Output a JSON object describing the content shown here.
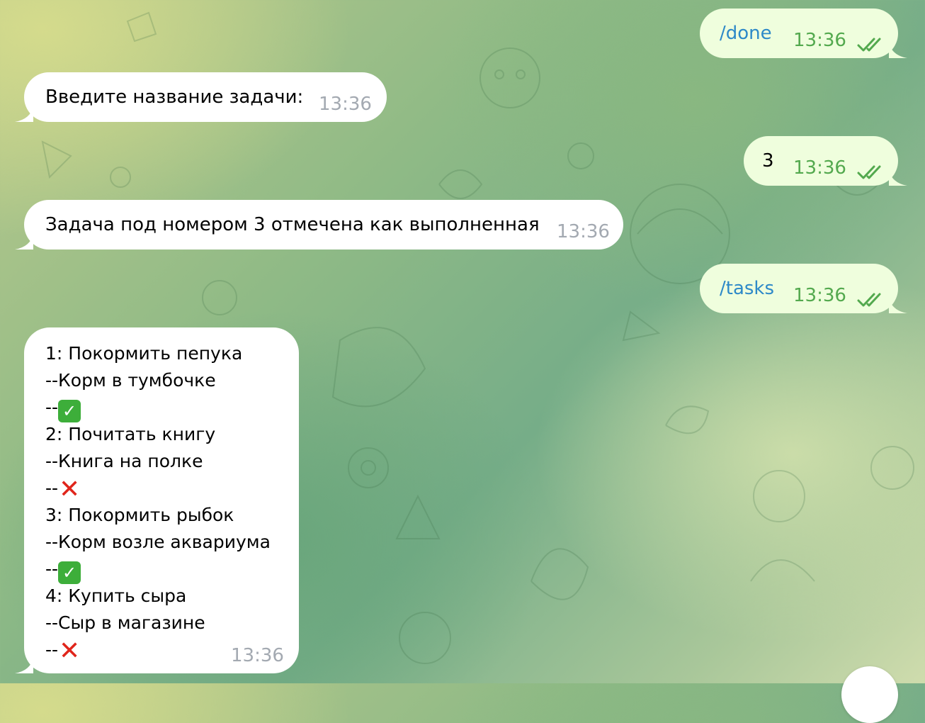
{
  "colors": {
    "incoming_bubble": "#ffffff",
    "outgoing_bubble": "#effedd",
    "command_link": "#2d89c8",
    "outgoing_time": "#53a94e",
    "incoming_time": "#a3a9b1",
    "done_mark": "#3dae3a",
    "not_done_mark": "#e0251b"
  },
  "messages": [
    {
      "direction": "out",
      "text": "/done",
      "time": "13:36",
      "status_icon": "double-check-icon"
    },
    {
      "direction": "in",
      "text": "Введите название задачи:",
      "time": "13:36"
    },
    {
      "direction": "out",
      "text": "3",
      "time": "13:36",
      "status_icon": "double-check-icon"
    },
    {
      "direction": "in",
      "text": "Задача под номером 3 отмечена как выполненная",
      "time": "13:36"
    },
    {
      "direction": "out",
      "text": "/tasks",
      "time": "13:36",
      "status_icon": "double-check-icon"
    },
    {
      "direction": "in",
      "time": "13:36",
      "tasks": [
        {
          "title": "1: Покормить пепука",
          "note": "--Корм в тумбочке",
          "status_prefix": "--",
          "status_icon": "check-mark-button-icon",
          "status_glyph": "✓"
        },
        {
          "title": "2: Почитать книгу",
          "note": "--Книга на полке",
          "status_prefix": "--",
          "status_icon": "cross-mark-icon",
          "status_glyph": "✕"
        },
        {
          "title": "3: Покормить рыбок",
          "note": "--Корм возле аквариума",
          "status_prefix": "--",
          "status_icon": "check-mark-button-icon",
          "status_glyph": "✓"
        },
        {
          "title": "4: Купить сыра",
          "note": "--Сыр в магазине",
          "status_prefix": "--",
          "status_icon": "cross-mark-icon",
          "status_glyph": "✕"
        }
      ]
    }
  ]
}
